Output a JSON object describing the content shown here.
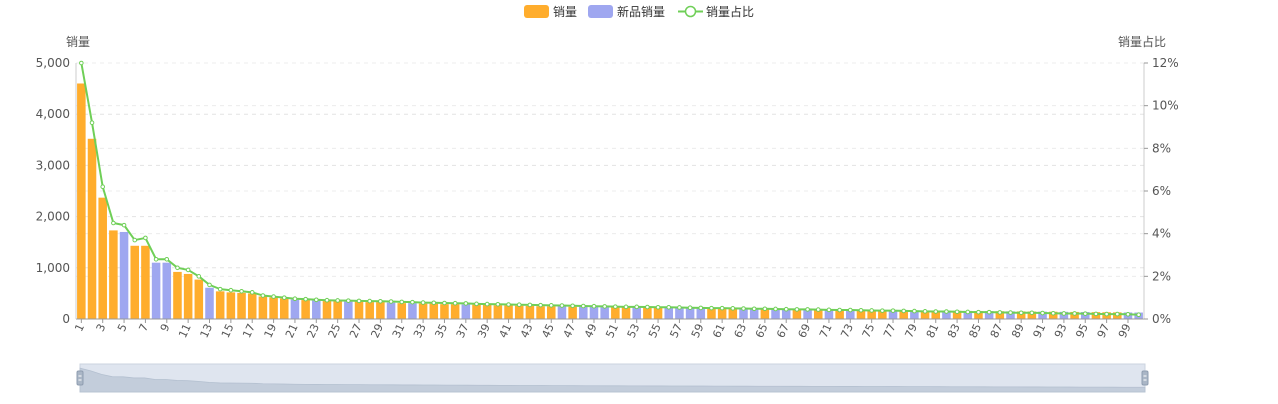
{
  "chart_data": {
    "type": "bar+line",
    "legend": {
      "placement": "top-center",
      "items": [
        {
          "label": "销量",
          "kind": "bar",
          "color": "#ffad2d"
        },
        {
          "label": "新品销量",
          "kind": "bar",
          "color": "#9fa7f0"
        },
        {
          "label": "销量占比",
          "kind": "line",
          "color": "#6fcf57"
        }
      ]
    },
    "y_left": {
      "label": "销量",
      "min": 0,
      "max": 5000,
      "ticks": [
        0,
        1000,
        2000,
        3000,
        4000,
        5000
      ],
      "tick_labels": [
        "0",
        "1,000",
        "2,000",
        "3,000",
        "4,000",
        "5,000"
      ]
    },
    "y_right": {
      "label": "销量占比",
      "min": 0,
      "max": 12,
      "ticks": [
        0,
        2,
        4,
        6,
        8,
        10,
        12
      ],
      "tick_labels": [
        "0%",
        "2%",
        "4%",
        "6%",
        "8%",
        "10%",
        "12%"
      ]
    },
    "x_ticks_shown": [
      "1",
      "3",
      "5",
      "7",
      "9",
      "11",
      "13",
      "15",
      "17",
      "19",
      "21",
      "23",
      "25",
      "27",
      "29",
      "31",
      "33",
      "35",
      "37",
      "39",
      "41",
      "43",
      "45",
      "47",
      "49",
      "51",
      "53",
      "55",
      "57",
      "59",
      "61",
      "63",
      "65",
      "67",
      "69",
      "71",
      "73",
      "75",
      "77",
      "79",
      "81",
      "83",
      "85",
      "87",
      "89",
      "91",
      "93",
      "95",
      "97",
      "99"
    ],
    "grid": true,
    "x": [
      1,
      2,
      3,
      4,
      5,
      6,
      7,
      8,
      9,
      10,
      11,
      12,
      13,
      14,
      15,
      16,
      17,
      18,
      19,
      20,
      21,
      22,
      23,
      24,
      25,
      26,
      27,
      28,
      29,
      30,
      31,
      32,
      33,
      34,
      35,
      36,
      37,
      38,
      39,
      40,
      41,
      42,
      43,
      44,
      45,
      46,
      47,
      48,
      49,
      50,
      51,
      52,
      53,
      54,
      55,
      56,
      57,
      58,
      59,
      60,
      61,
      62,
      63,
      64,
      65,
      66,
      67,
      68,
      69,
      70,
      71,
      72,
      73,
      74,
      75,
      76,
      77,
      78,
      79,
      80,
      81,
      82,
      83,
      84,
      85,
      86,
      87,
      88,
      89,
      90,
      91,
      92,
      93,
      94,
      95,
      96,
      97,
      98,
      99,
      100
    ],
    "sales": [
      4600,
      3520,
      2370,
      1730,
      1700,
      1430,
      1430,
      1100,
      1100,
      920,
      880,
      770,
      610,
      540,
      520,
      510,
      500,
      440,
      420,
      400,
      380,
      370,
      360,
      350,
      350,
      340,
      340,
      330,
      330,
      320,
      310,
      310,
      300,
      300,
      290,
      290,
      285,
      280,
      275,
      270,
      265,
      260,
      255,
      250,
      248,
      245,
      240,
      238,
      235,
      232,
      230,
      228,
      225,
      222,
      220,
      218,
      215,
      212,
      210,
      208,
      205,
      202,
      200,
      198,
      196,
      194,
      192,
      190,
      188,
      186,
      184,
      182,
      180,
      178,
      176,
      174,
      172,
      170,
      168,
      166,
      164,
      162,
      160,
      158,
      156,
      154,
      152,
      150,
      148,
      146,
      144,
      142,
      140,
      138,
      136,
      134,
      132,
      130,
      128,
      126
    ],
    "new_product": [
      false,
      false,
      false,
      false,
      true,
      false,
      false,
      true,
      true,
      false,
      false,
      false,
      true,
      false,
      false,
      false,
      false,
      false,
      false,
      false,
      true,
      false,
      true,
      false,
      false,
      true,
      false,
      false,
      false,
      true,
      false,
      true,
      false,
      false,
      false,
      false,
      true,
      false,
      false,
      false,
      false,
      false,
      false,
      false,
      false,
      true,
      false,
      true,
      true,
      true,
      false,
      false,
      true,
      false,
      false,
      true,
      true,
      true,
      true,
      false,
      false,
      false,
      true,
      true,
      false,
      true,
      true,
      false,
      true,
      false,
      true,
      false,
      true,
      false,
      false,
      false,
      true,
      false,
      true,
      false,
      false,
      true,
      false,
      true,
      false,
      true,
      false,
      true,
      false,
      false,
      true,
      false,
      true,
      false,
      true,
      false,
      false,
      false,
      true,
      true
    ],
    "share_pct": [
      12.0,
      9.2,
      6.2,
      4.5,
      4.4,
      3.7,
      3.8,
      2.8,
      2.8,
      2.4,
      2.3,
      2.0,
      1.6,
      1.4,
      1.35,
      1.3,
      1.25,
      1.1,
      1.05,
      1.0,
      0.95,
      0.93,
      0.9,
      0.88,
      0.87,
      0.86,
      0.85,
      0.84,
      0.83,
      0.82,
      0.8,
      0.79,
      0.77,
      0.76,
      0.75,
      0.74,
      0.73,
      0.71,
      0.7,
      0.69,
      0.68,
      0.67,
      0.66,
      0.65,
      0.64,
      0.63,
      0.62,
      0.61,
      0.6,
      0.59,
      0.58,
      0.57,
      0.57,
      0.56,
      0.55,
      0.55,
      0.54,
      0.53,
      0.52,
      0.51,
      0.51,
      0.5,
      0.49,
      0.48,
      0.48,
      0.47,
      0.46,
      0.45,
      0.45,
      0.44,
      0.43,
      0.42,
      0.42,
      0.41,
      0.4,
      0.39,
      0.39,
      0.38,
      0.37,
      0.36,
      0.35,
      0.35,
      0.34,
      0.33,
      0.32,
      0.32,
      0.31,
      0.3,
      0.29,
      0.29,
      0.28,
      0.27,
      0.26,
      0.26,
      0.25,
      0.24,
      0.23,
      0.23,
      0.22,
      0.2
    ]
  }
}
